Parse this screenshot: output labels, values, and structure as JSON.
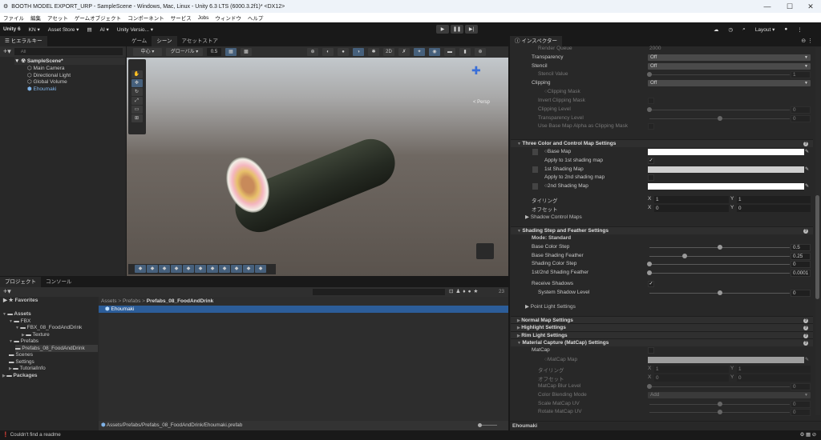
{
  "window": {
    "title": "BOOTH MODEL EXPORT_URP - SampleScene - Windows, Mac, Linux - Unity 6.3 LTS (6000.3.2f1)* <DX12>",
    "minimize": "—",
    "maximize": "☐",
    "close": "✕"
  },
  "menu": [
    "ファイル",
    "編集",
    "アセット",
    "ゲームオブジェクト",
    "コンポーネント",
    "サービス",
    "Jobs",
    "ウィンドウ",
    "ヘルプ"
  ],
  "toolbar": {
    "unity": "Unity 6",
    "account": "KN ▾",
    "asset_store": "Asset Store ▾",
    "ai": "AI ▾",
    "version_control": "Unity Versio... ▾",
    "layout": "Layout ▾",
    "play": "▶",
    "pause": "❚❚",
    "step": "▶|"
  },
  "hierarchy": {
    "tab": "ヒエラルキー",
    "search_placeholder": "All",
    "scene": "SampleScene*",
    "items": [
      "Main Camera",
      "Directional Light",
      "Global Volume",
      "Ehoumaki"
    ]
  },
  "scene_tabs": [
    "ゲーム",
    "シーン",
    "アセットストア"
  ],
  "scene_toolbar": {
    "pivot": "中心 ▾",
    "space": "グローバル ▾",
    "snap": "0.5",
    "persp": "< Persp"
  },
  "project": {
    "tabs": [
      "プロジェクト",
      "コンソール"
    ],
    "count": "23",
    "favorites": "Favorites",
    "tree": [
      {
        "label": "Assets",
        "depth": 0,
        "arrow": "▼"
      },
      {
        "label": "FBX",
        "depth": 1,
        "arrow": "▼"
      },
      {
        "label": "FBX_08_FoodAndDrink",
        "depth": 2,
        "arrow": "▼"
      },
      {
        "label": "Texture",
        "depth": 3,
        "arrow": "▶"
      },
      {
        "label": "Prefabs",
        "depth": 1,
        "arrow": "▼"
      },
      {
        "label": "Prefabs_08_FoodAndDrink",
        "depth": 2,
        "arrow": ""
      },
      {
        "label": "Scenes",
        "depth": 1,
        "arrow": ""
      },
      {
        "label": "Settings",
        "depth": 1,
        "arrow": ""
      },
      {
        "label": "TutorialInfo",
        "depth": 1,
        "arrow": "▶"
      },
      {
        "label": "Packages",
        "depth": 0,
        "arrow": "▶"
      }
    ],
    "breadcrumb": [
      "Assets",
      "Prefabs",
      "Prefabs_08_FoodAndDrink"
    ],
    "files": [
      "Ehoumaki"
    ],
    "path": "Assets/Prefabs/Prefabs_08_FoodAndDrink/Ehoumaki.prefab"
  },
  "inspector": {
    "tab": "インスペクター",
    "footer": "Ehoumaki",
    "rows": [
      {
        "label": "Render Queue",
        "type": "text",
        "value": "2000",
        "dis": true,
        "ind": 1
      },
      {
        "label": "Transparency",
        "type": "dd",
        "value": "Off",
        "ind": 0
      },
      {
        "label": "Stencil",
        "type": "dd",
        "value": "Off",
        "ind": 0
      },
      {
        "label": "Stencil Value",
        "type": "slider",
        "value": "1",
        "frac": 0,
        "dis": true,
        "ind": 1
      },
      {
        "label": "Clipping",
        "type": "dd",
        "value": "Off",
        "ind": 0
      },
      {
        "label": "○Clipping Mask",
        "type": "none",
        "dis": true,
        "ind": 2
      },
      {
        "label": "Invert Clipping Mask",
        "type": "chk",
        "value": "",
        "dis": true,
        "ind": 1
      },
      {
        "label": "Clipping Level",
        "type": "slider",
        "value": "0",
        "frac": 0,
        "dis": true,
        "ind": 1
      },
      {
        "label": "Transparency Level",
        "type": "slider",
        "value": "0",
        "frac": 0.5,
        "dis": true,
        "ind": 1
      },
      {
        "label": "Use Base Map Alpha as Clipping Mask",
        "type": "chk",
        "value": "",
        "dis": true,
        "ind": 1
      },
      {
        "label": "Three Color and Control Map Settings",
        "type": "header",
        "open": true
      },
      {
        "label": "○Base Map",
        "type": "tex",
        "ind": 2
      },
      {
        "label": "Apply to 1st shading map",
        "type": "chk",
        "value": "✓",
        "ind": 2
      },
      {
        "label": "1st Shading Map",
        "type": "tex",
        "tint": "#cfcfcf",
        "ind": 2
      },
      {
        "label": "Apply to 2nd shading map",
        "type": "chk",
        "value": "",
        "ind": 2
      },
      {
        "label": "○2nd Shading Map",
        "type": "tex",
        "ind": 2
      },
      {
        "label": "タイリング",
        "type": "xy",
        "x": "1",
        "y": "1",
        "ind": 0
      },
      {
        "label": "オフセット",
        "type": "xy",
        "x": "0",
        "y": "0",
        "ind": 0
      },
      {
        "label": "▶ Shadow Control Maps",
        "type": "none",
        "ind": -1
      },
      {
        "label": "Shading Step and Feather Settings",
        "type": "header",
        "open": true
      },
      {
        "label": "Mode: Standard",
        "type": "none",
        "bold": true,
        "ind": 0
      },
      {
        "label": "Base Color Step",
        "type": "slider",
        "value": "0.5",
        "frac": 0.5,
        "ind": 0
      },
      {
        "label": "Base Shading Feather",
        "type": "slider",
        "value": "0.25",
        "frac": 0.25,
        "ind": 0
      },
      {
        "label": "Shading Color Step",
        "type": "slider",
        "value": "0",
        "frac": 0,
        "ind": 0
      },
      {
        "label": "1st/2nd Shading Feather",
        "type": "slider",
        "value": "0.0001",
        "frac": 0,
        "ind": 0
      },
      {
        "label": "Receive Shadows",
        "type": "chk",
        "value": "✓",
        "ind": 0
      },
      {
        "label": "System Shadow Level",
        "type": "slider",
        "value": "0",
        "frac": 0.5,
        "ind": 1
      },
      {
        "label": "▶ Point Light Settings",
        "type": "none",
        "ind": -1
      },
      {
        "label": "Normal Map Settings",
        "type": "header",
        "open": false
      },
      {
        "label": "Highlight Settings",
        "type": "header",
        "open": false
      },
      {
        "label": "Rim Light Settings",
        "type": "header",
        "open": false
      },
      {
        "label": "Material Capture (MatCap) Settings",
        "type": "header",
        "open": true
      },
      {
        "label": "MatCap",
        "type": "chk",
        "value": "",
        "ind": 0
      },
      {
        "label": "○MatCap Map",
        "type": "tex",
        "dis": true,
        "ind": 2
      },
      {
        "label": "タイリング",
        "type": "xy",
        "x": "1",
        "y": "1",
        "dis": true,
        "ind": 1
      },
      {
        "label": "オフセット",
        "type": "xy",
        "x": "0",
        "y": "0",
        "dis": true,
        "ind": 1
      },
      {
        "label": "MatCap Blur Level",
        "type": "slider",
        "value": "0",
        "frac": 0,
        "dis": true,
        "ind": 1
      },
      {
        "label": "Color Blending Mode",
        "type": "dd",
        "value": "Add",
        "dis": true,
        "ind": 1
      },
      {
        "label": "Scale MatCap UV",
        "type": "slider",
        "value": "0",
        "frac": 0.5,
        "dis": true,
        "ind": 1
      },
      {
        "label": "Rotate MatCap UV",
        "type": "slider",
        "value": "0",
        "frac": 0.5,
        "dis": true,
        "ind": 1
      }
    ]
  },
  "status": {
    "message": "Couldn't find a readme"
  }
}
